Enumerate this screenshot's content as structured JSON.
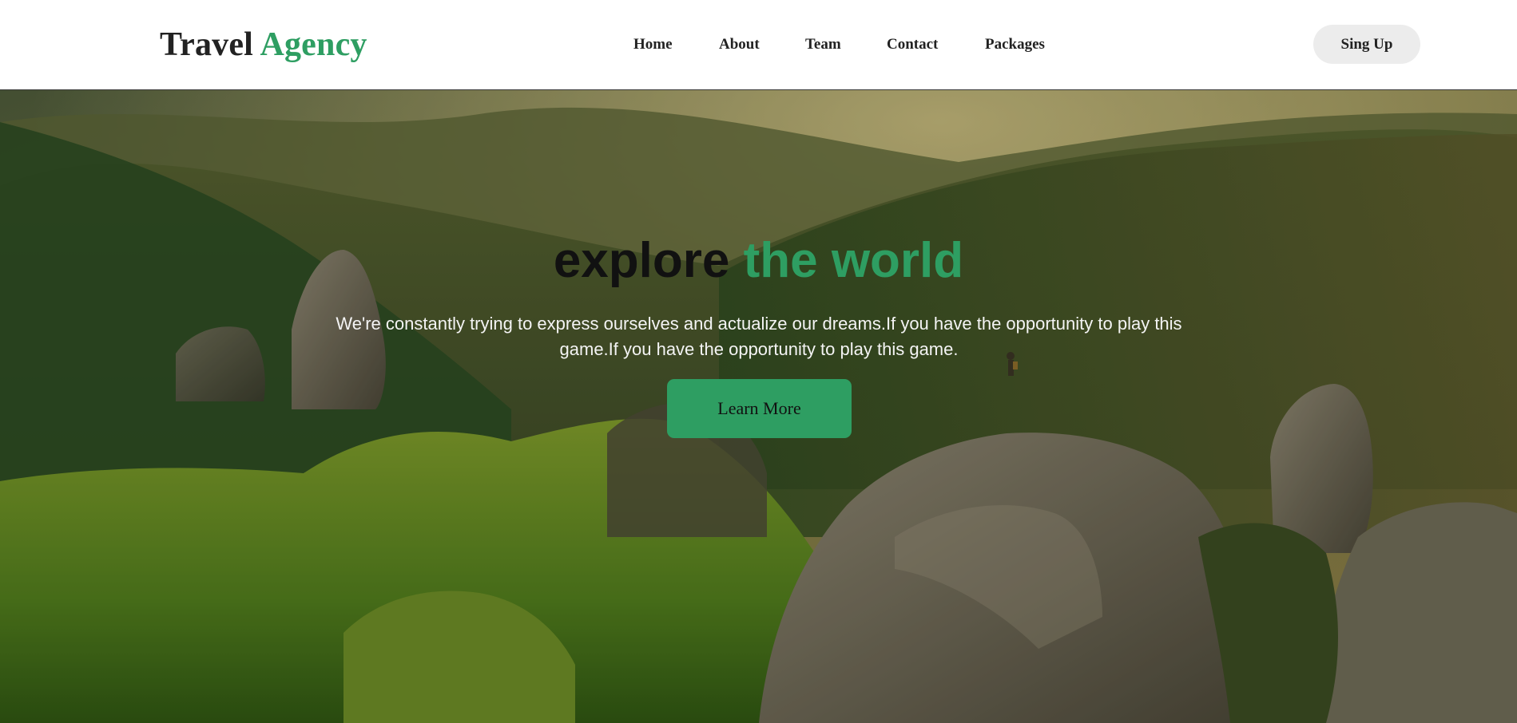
{
  "header": {
    "logo_main": "Travel",
    "logo_accent": "Agency",
    "nav": {
      "home": "Home",
      "about": "About",
      "team": "Team",
      "contact": "Contact",
      "packages": "Packages"
    },
    "signup_label": "Sing Up"
  },
  "hero": {
    "title_main": "explore",
    "title_accent": "the world",
    "text": "We're constantly trying to express ourselves and actualize our dreams.If you have the opportunity to play this game.If you have the opportunity to play this game.",
    "button_label": "Learn More"
  },
  "colors": {
    "accent": "#2e9e62",
    "text_dark": "#222222",
    "signup_bg": "#ececec",
    "hero_text": "#f4f4f4"
  }
}
